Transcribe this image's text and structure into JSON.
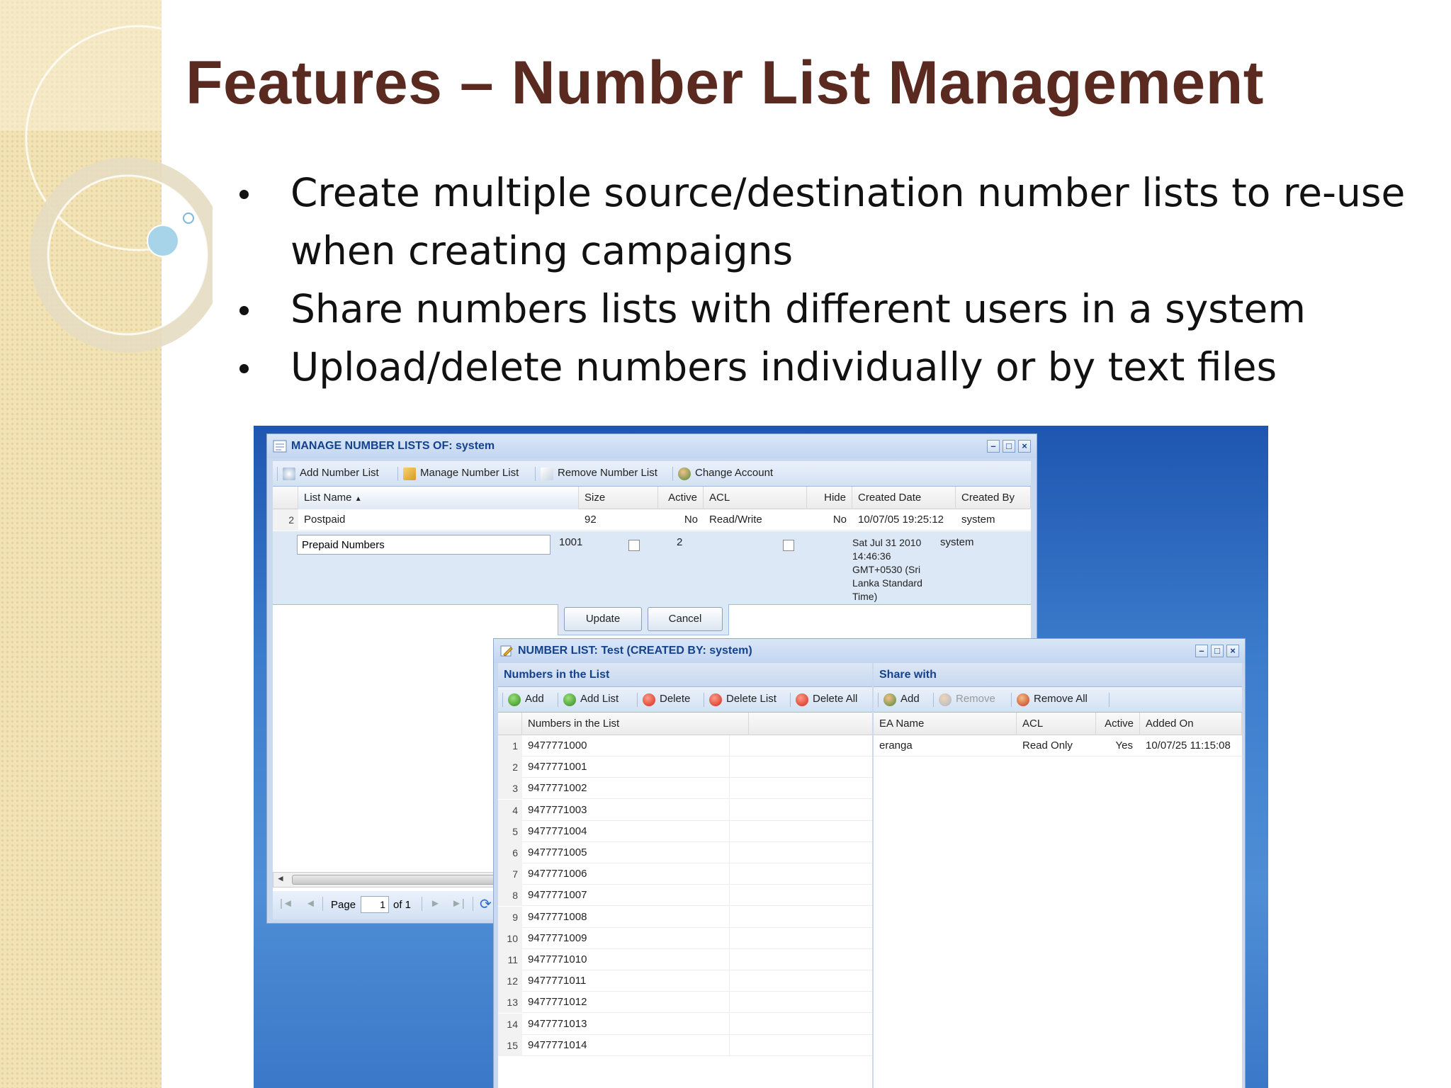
{
  "slide": {
    "title": "Features – Number List Management",
    "bullets": [
      "Create multiple source/destination number lists to re-use",
      "when creating campaigns",
      "Share numbers lists with different users in a system",
      "Upload/delete numbers individually or by text files"
    ]
  },
  "manage_window": {
    "title": "MANAGE NUMBER LISTS OF: system",
    "toolbar": [
      "Add Number List",
      "Manage Number List",
      "Remove Number List",
      "Change Account"
    ],
    "columns": [
      "List Name",
      "Size",
      "Active",
      "ACL",
      "Hide",
      "Created Date",
      "Created By"
    ],
    "rows": [
      {
        "num": "2",
        "name": "Postpaid",
        "size": "92",
        "active": "No",
        "acl": "Read/Write",
        "hide": "No",
        "created": "10/07/05 19:25:12",
        "by": "system"
      }
    ],
    "edit_row": {
      "name": "Prepaid Numbers",
      "size": "1001",
      "acl": "2",
      "created": [
        "Sat Jul 31 2010",
        "14:46:36",
        "GMT+0530 (Sri",
        "Lanka Standard",
        "Time)"
      ],
      "by": "system"
    },
    "update_label": "Update",
    "cancel_label": "Cancel",
    "pager": {
      "page_label": "Page",
      "page_value": "1",
      "of_label": "of 1"
    }
  },
  "number_window": {
    "title": "NUMBER LIST: Test (CREATED BY: system)",
    "numbers_section": "Numbers in the List",
    "numbers_toolbar": [
      "Add",
      "Add List",
      "Delete",
      "Delete List",
      "Delete All"
    ],
    "numbers_column": "Numbers in the List",
    "numbers": [
      "9477771000",
      "9477771001",
      "9477771002",
      "9477771003",
      "9477771004",
      "9477771005",
      "9477771006",
      "9477771007",
      "9477771008",
      "9477771009",
      "9477771010",
      "9477771011",
      "9477771012",
      "9477771013",
      "9477771014"
    ],
    "share_section": "Share with",
    "share_toolbar": [
      "Add",
      "Remove",
      "Remove All"
    ],
    "share_columns": [
      "EA Name",
      "ACL",
      "Active",
      "Added On"
    ],
    "share_rows": [
      {
        "name": "eranga",
        "acl": "Read Only",
        "active": "Yes",
        "added": "10/07/25 11:15:08"
      }
    ]
  },
  "colors": {
    "title": "#5a2a20",
    "window_header": "#15428b",
    "desktop": "#3c7ccc"
  }
}
